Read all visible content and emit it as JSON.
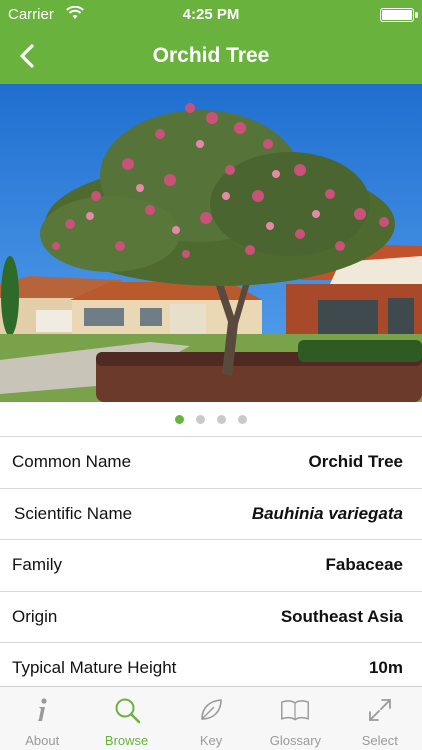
{
  "status_bar": {
    "carrier": "Carrier",
    "time": "4:25 PM",
    "battery_level": 1.0
  },
  "nav": {
    "title": "Orchid Tree",
    "back_icon": "chevron-left-icon"
  },
  "photo": {
    "page_count": 4,
    "active_page": 1
  },
  "details": [
    {
      "label": "Common Name",
      "value": "Orchid Tree",
      "italic": false
    },
    {
      "label": "Scientific Name",
      "value": "Bauhinia variegata",
      "italic": true
    },
    {
      "label": "Family",
      "value": "Fabaceae",
      "italic": false
    },
    {
      "label": "Origin",
      "value": "Southeast Asia",
      "italic": false
    },
    {
      "label": "Typical Mature Height",
      "value": "10m",
      "italic": false
    }
  ],
  "tabs": [
    {
      "label": "About",
      "icon": "info-icon",
      "active": false
    },
    {
      "label": "Browse",
      "icon": "search-icon",
      "active": true
    },
    {
      "label": "Key",
      "icon": "leaf-icon",
      "active": false
    },
    {
      "label": "Glossary",
      "icon": "book-icon",
      "active": false
    },
    {
      "label": "Select",
      "icon": "expand-icon",
      "active": false
    }
  ],
  "colors": {
    "accent": "#6ab23e",
    "inactive": "#9a9a9a"
  }
}
